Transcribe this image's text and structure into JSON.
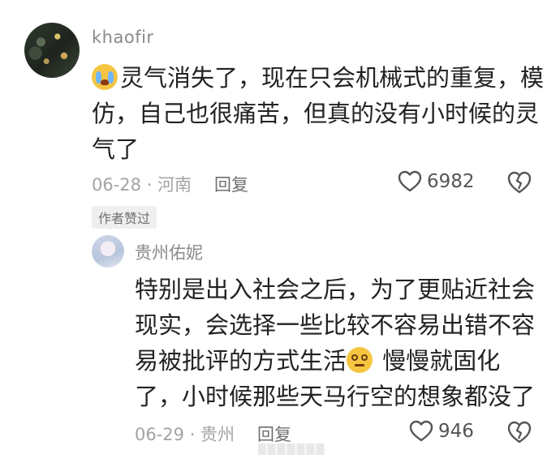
{
  "main_comment": {
    "username": "khaofir",
    "emoji": "loudly-crying-face-emoji",
    "text": "灵气消失了，现在只会机械式的重复，模仿，自己也很痛苦，但真的没有小时候的灵气了",
    "date_location": "06-28 · 河南",
    "reply_label": "回复",
    "likes": "6982",
    "author_liked_badge": "作者赞过"
  },
  "reply_comment": {
    "username": "贵州佑妮",
    "text_before_emoji": "特别是出入社会之后，为了更贴近社会现实，会选择一些比较不容易出错不容易被批评的方式生活",
    "emoji": "dizzy-face-emoji",
    "text_after_emoji": " 慢慢就固化了，小时候那些天马行空的想象都没了",
    "date_location": "06-29 · 贵州",
    "reply_label": "回复",
    "likes": "946"
  },
  "colors": {
    "text_primary": "#222222",
    "text_secondary": "#8a8a8a",
    "badge_bg": "#efefef"
  }
}
